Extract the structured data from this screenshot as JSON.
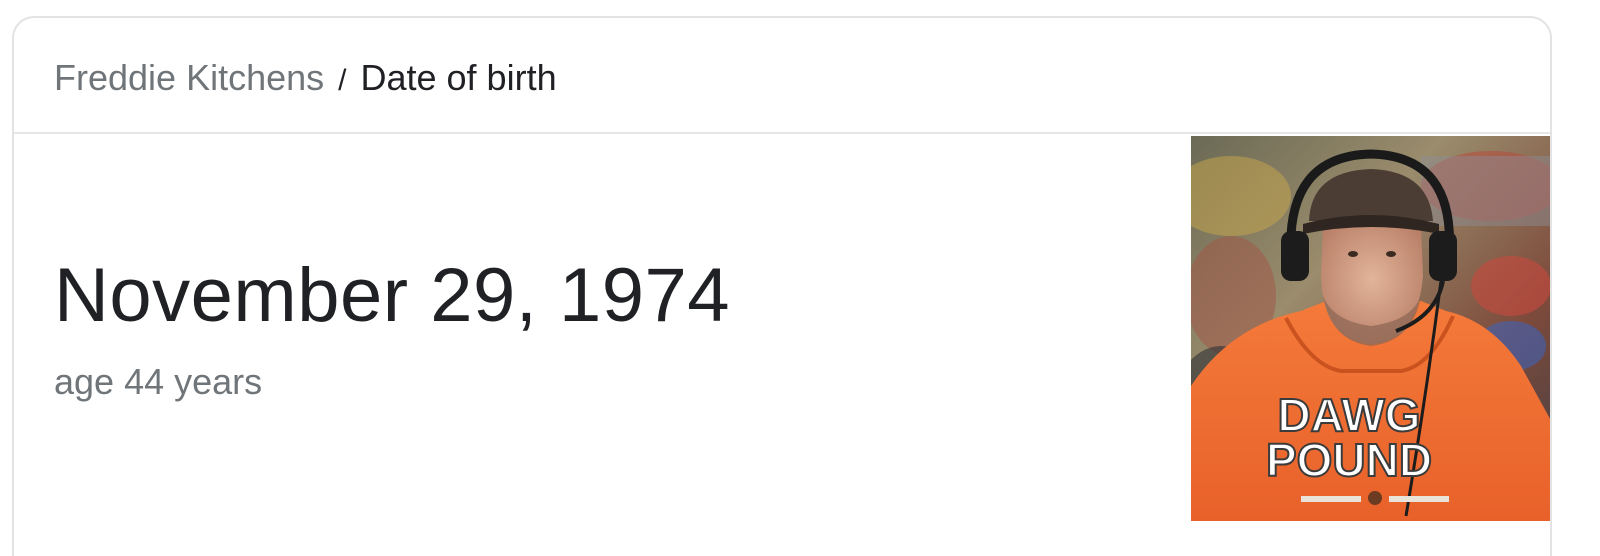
{
  "breadcrumb": {
    "parent": "Freddie Kitchens",
    "separator": "/",
    "current": "Date of birth"
  },
  "answer": {
    "date": "November 29, 1974",
    "age": "age 44 years"
  },
  "photo": {
    "alt": "Freddie Kitchens",
    "hoodie_text_line1": "DAWG",
    "hoodie_text_line2": "POUND"
  },
  "colors": {
    "primary_text": "#202124",
    "secondary_text": "#70757a",
    "border": "#e3e3e3",
    "hoodie_orange": "#f26a2c"
  }
}
